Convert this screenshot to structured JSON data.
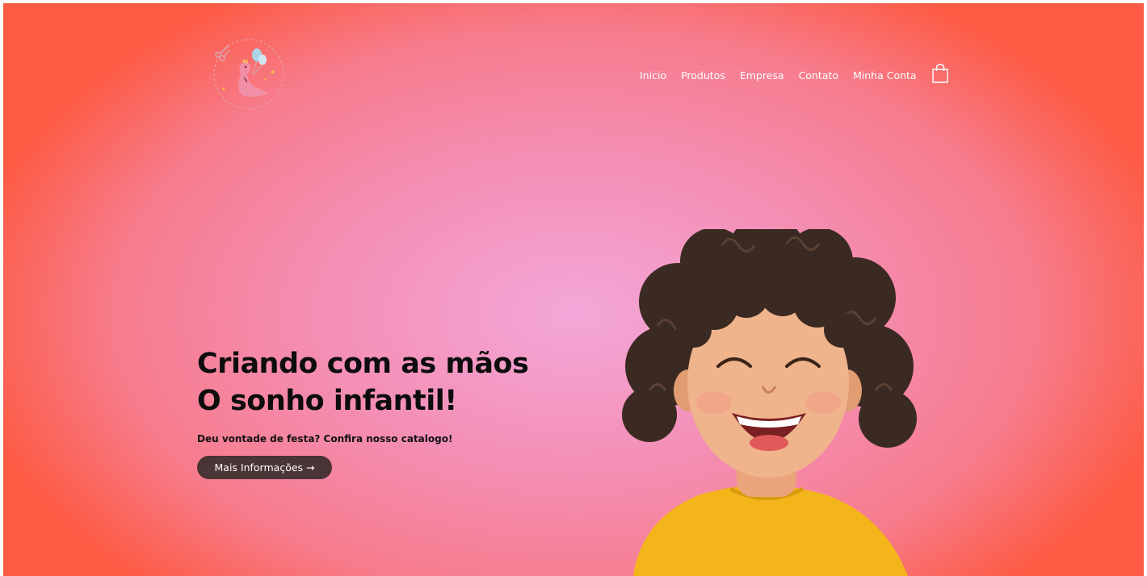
{
  "brand": {
    "logo_icon": "party-dino-logo-icon"
  },
  "nav": {
    "items": [
      {
        "label": "Inicio"
      },
      {
        "label": "Produtos"
      },
      {
        "label": "Empresa"
      },
      {
        "label": "Contato"
      },
      {
        "label": "Minha Conta"
      }
    ],
    "cart_icon": "shopping-bag-icon"
  },
  "hero": {
    "title_line1": "Criando com as mãos",
    "title_line2": "O sonho infantil!",
    "subtitle": "Deu vontade de festa? Confira nosso catalogo!",
    "cta_label": "Mais Informações →",
    "image_icon": "smiling-child-photo"
  },
  "colors": {
    "gradient_center": "#f3a7d8",
    "gradient_edge": "#fd5b44",
    "cta_background": "#4a3435",
    "nav_text": "#ffffff"
  }
}
